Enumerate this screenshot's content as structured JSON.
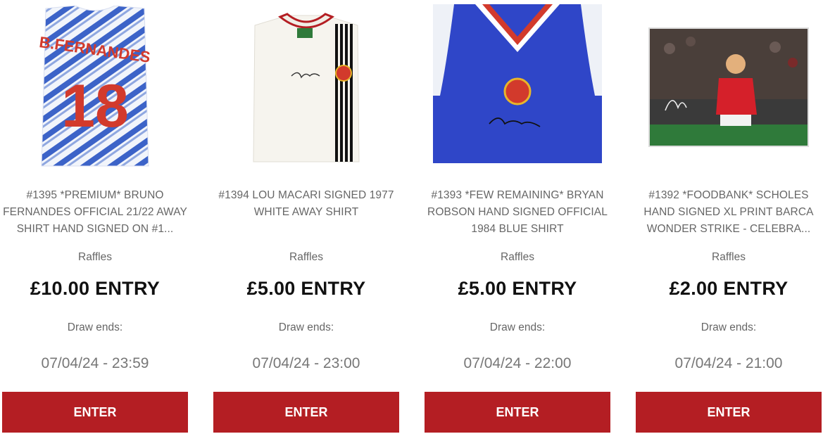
{
  "raffles": [
    {
      "title": "#1395 *PREMIUM* BRUNO FERNANDES OFFICIAL 21/22 AWAY SHIRT HAND SIGNED ON #1...",
      "category": "Raffles",
      "price": "£10.00 ENTRY",
      "draw_label": "Draw ends:",
      "draw_date": "07/04/24 - 23:59",
      "button": "ENTER",
      "image": {
        "icon": "blue-away-shirt-image",
        "shirt_name": "B.FERNANDES",
        "shirt_number": "18"
      }
    },
    {
      "title": "#1394 LOU MACARI SIGNED 1977 WHITE AWAY SHIRT",
      "category": "Raffles",
      "price": "£5.00 ENTRY",
      "draw_label": "Draw ends:",
      "draw_date": "07/04/24 - 23:00",
      "button": "ENTER",
      "image": {
        "icon": "white-retro-shirt-image"
      }
    },
    {
      "title": "#1393 *FEW REMAINING* BRYAN ROBSON HAND SIGNED OFFICIAL 1984 BLUE SHIRT",
      "category": "Raffles",
      "price": "£5.00 ENTRY",
      "draw_label": "Draw ends:",
      "draw_date": "07/04/24 - 22:00",
      "button": "ENTER",
      "image": {
        "icon": "blue-vest-shirt-image"
      }
    },
    {
      "title": "#1392 *FOODBANK* SCHOLES HAND SIGNED XL PRINT BARCA WONDER STRIKE - CELEBRA...",
      "category": "Raffles",
      "price": "£2.00 ENTRY",
      "draw_label": "Draw ends:",
      "draw_date": "07/04/24 - 21:00",
      "button": "ENTER",
      "image": {
        "icon": "signed-photo-print-image"
      }
    }
  ],
  "colors": {
    "button_red": "#b41e23",
    "shirt_blue": "#2f46c8",
    "number_red": "#d23a2c"
  }
}
